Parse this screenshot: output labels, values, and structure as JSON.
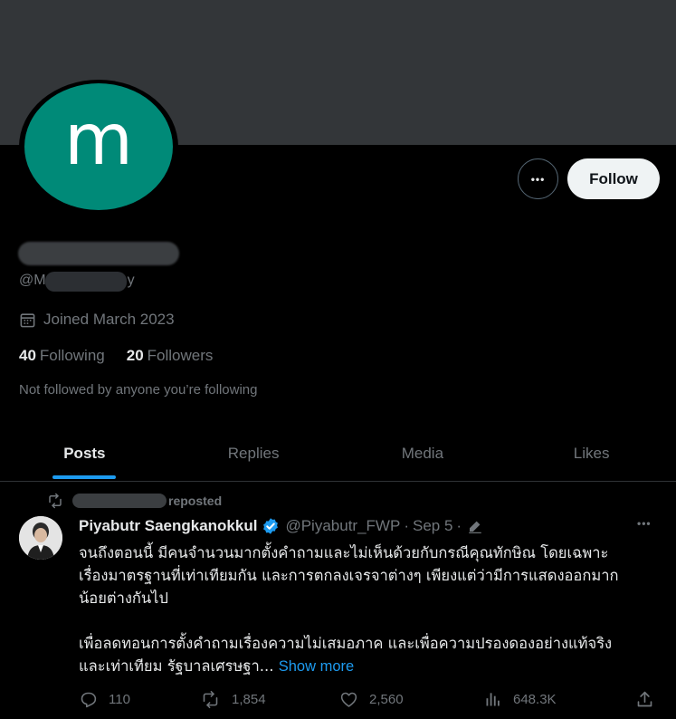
{
  "profile": {
    "avatar_letter": "m",
    "avatar_color": "#008a78",
    "handle_prefix": "@M",
    "handle_suffix": "y",
    "joined": "Joined March 2023",
    "following_count": "40",
    "following_label": "Following",
    "followers_count": "20",
    "followers_label": "Followers",
    "not_followed_text": "Not followed by anyone you’re following",
    "follow_label": "Follow",
    "more_label": "•••"
  },
  "tabs": [
    {
      "label": "Posts",
      "active": true
    },
    {
      "label": "Replies",
      "active": false
    },
    {
      "label": "Media",
      "active": false
    },
    {
      "label": "Likes",
      "active": false
    }
  ],
  "tweet": {
    "repost_suffix": "reposted",
    "author_name": "Piyabutr Saengkanokkul",
    "author_handle": "@Piyabutr_FWP",
    "date": "Sep 5",
    "separator": "·",
    "more_label": "•••",
    "text_lines": [
      "จนถึงตอนนี้ มีคนจำนวนมากตั้งคำถามและไม่เห็นด้วยกับกรณีคุณทักษิณ โดยเฉพาะ",
      "เรื่องมาตรฐานที่เท่าเทียมกัน และการตกลงเจรจาต่างๆ เพียงแต่ว่ามีการแสดงออกมาก",
      "น้อยต่างกันไป"
    ],
    "text_lines_2": [
      "เพื่อลดทอนการตั้งคำถามเรื่องความไม่เสมอภาค และเพื่อความปรองดองอย่างแท้จริง",
      "และเท่าเทียม รัฐบาลเศรษฐา..."
    ],
    "show_more": "Show more",
    "replies": "110",
    "reposts": "1,854",
    "likes": "2,560",
    "views": "648.3K"
  },
  "colors": {
    "accent": "#1d9bf0",
    "muted": "#71767b",
    "text": "#e7e9ea",
    "background": "#000000",
    "banner": "#333639"
  }
}
